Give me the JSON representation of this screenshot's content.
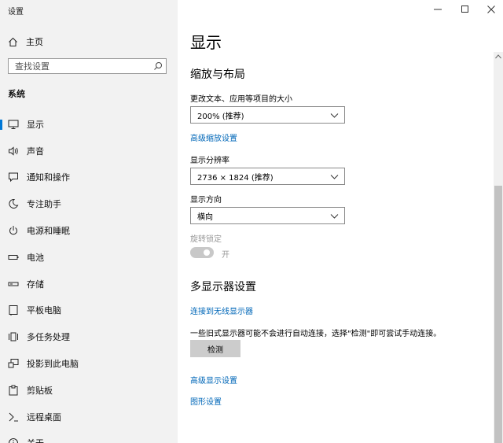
{
  "app": {
    "title": "设置"
  },
  "sidebar": {
    "home_label": "主页",
    "search_placeholder": "查找设置",
    "section_label": "系统",
    "items": [
      {
        "label": "显示",
        "icon": "monitor-icon",
        "active": true
      },
      {
        "label": "声音",
        "icon": "speaker-icon"
      },
      {
        "label": "通知和操作",
        "icon": "notification-icon"
      },
      {
        "label": "专注助手",
        "icon": "moon-icon"
      },
      {
        "label": "电源和睡眠",
        "icon": "power-icon"
      },
      {
        "label": "电池",
        "icon": "battery-icon"
      },
      {
        "label": "存储",
        "icon": "storage-icon"
      },
      {
        "label": "平板电脑",
        "icon": "tablet-icon"
      },
      {
        "label": "多任务处理",
        "icon": "multitasking-icon"
      },
      {
        "label": "投影到此电脑",
        "icon": "projector-icon"
      },
      {
        "label": "剪贴板",
        "icon": "clipboard-icon"
      },
      {
        "label": "远程桌面",
        "icon": "remote-desktop-icon"
      },
      {
        "label": "关于",
        "icon": "info-icon"
      }
    ]
  },
  "main": {
    "title": "显示",
    "scale_section": {
      "heading": "缩放与布局",
      "scale_label": "更改文本、应用等项目的大小",
      "scale_value": "200% (推荐)",
      "advanced_scale_link": "高级缩放设置",
      "resolution_label": "显示分辨率",
      "resolution_value": "2736 × 1824 (推荐)",
      "orientation_label": "显示方向",
      "orientation_value": "横向",
      "rotation_lock_label": "旋转锁定",
      "rotation_lock_state": "开"
    },
    "multi_section": {
      "heading": "多显示器设置",
      "wireless_link": "连接到无线显示器",
      "description": "一些旧式显示器可能不会进行自动连接，选择\"检测\"即可尝试手动连接。",
      "detect_button": "检测",
      "advanced_display_link": "高级显示设置",
      "graphics_link": "图形设置"
    }
  },
  "colors": {
    "accent": "#0078d7",
    "link": "#0067b8",
    "sidebar_bg": "#f2f2f2"
  }
}
